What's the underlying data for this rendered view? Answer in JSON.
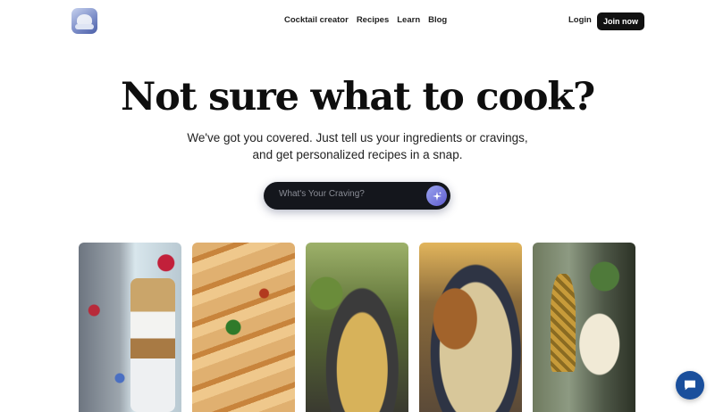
{
  "nav": {
    "items": [
      "Cocktail creator",
      "Recipes",
      "Learn",
      "Blog"
    ],
    "login_label": "Login",
    "join_label": "Join now"
  },
  "hero": {
    "title": "Not sure what to cook?",
    "subtitle_line1": "We've got you covered. Just tell us your ingredients or cravings,",
    "subtitle_line2": "and get personalized recipes in a snap."
  },
  "search": {
    "placeholder": "What's Your Craving?",
    "value": ""
  },
  "icons": {
    "logo": "app-logo",
    "submit": "sparkle-icon",
    "chat": "chat-bubble-icon"
  },
  "colors": {
    "accent": "#111111",
    "search_bg": "#14161c",
    "sparkle_from": "#9aa4ef",
    "sparkle_to": "#5f5ccf",
    "chat": "#1a4f9c"
  }
}
